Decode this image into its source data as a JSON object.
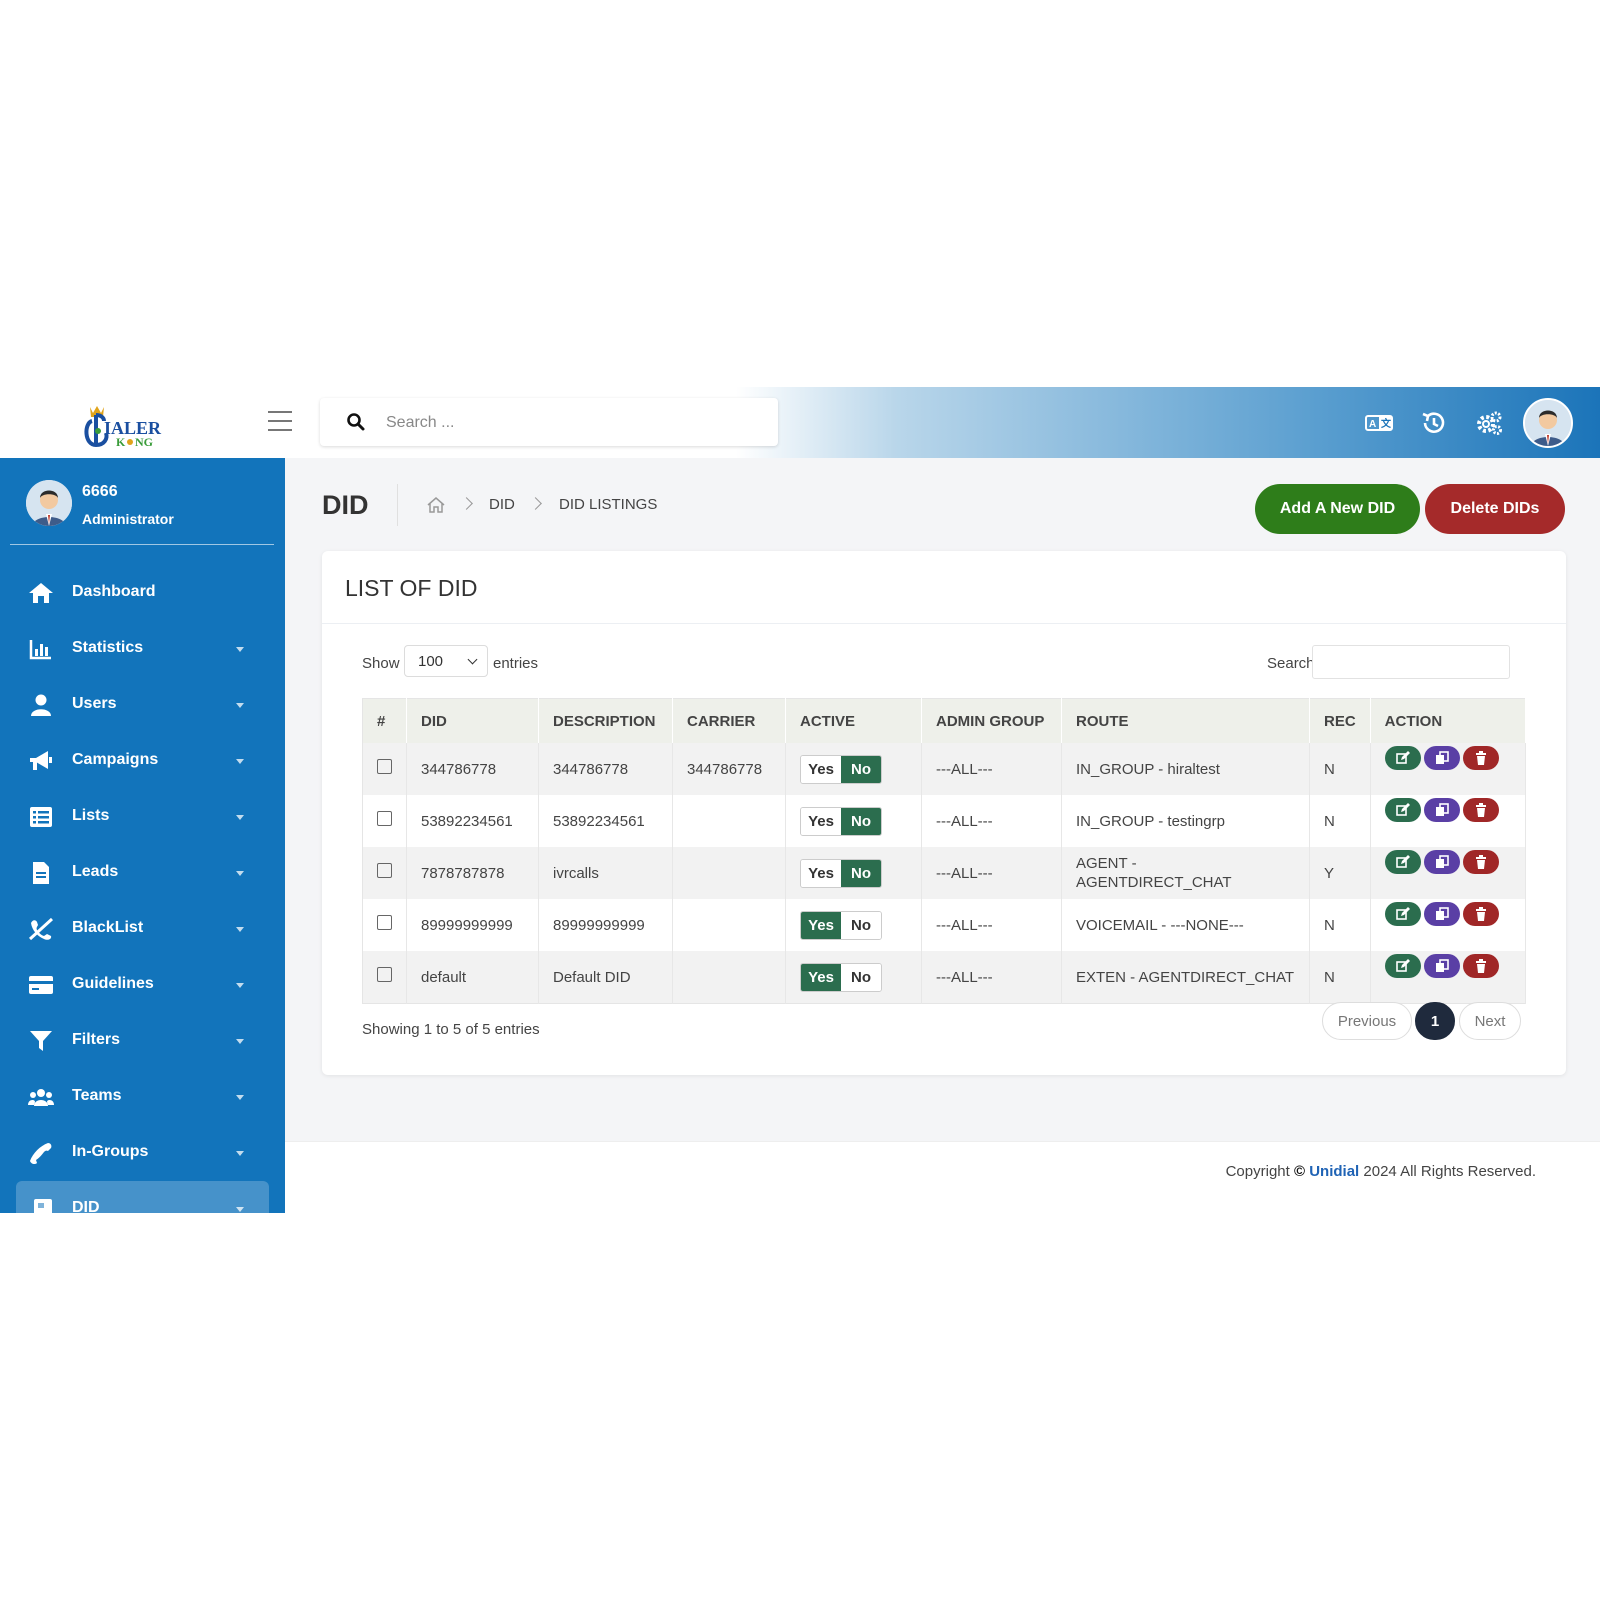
{
  "brand": {
    "logo_main": "IALER",
    "logo_sub": "KING",
    "logo_letter": "D"
  },
  "search": {
    "placeholder": "Search ..."
  },
  "topbar_icons": [
    "translate-icon",
    "history-icon",
    "settings-icon",
    "user-avatar"
  ],
  "user": {
    "name": "6666",
    "role": "Administrator"
  },
  "sidebar": {
    "items": [
      {
        "label": "Dashboard",
        "icon": "home-icon",
        "has_caret": false
      },
      {
        "label": "Statistics",
        "icon": "bar-chart-icon",
        "has_caret": true
      },
      {
        "label": "Users",
        "icon": "user-icon",
        "has_caret": true
      },
      {
        "label": "Campaigns",
        "icon": "megaphone-icon",
        "has_caret": true
      },
      {
        "label": "Lists",
        "icon": "list-icon",
        "has_caret": true
      },
      {
        "label": "Leads",
        "icon": "document-icon",
        "has_caret": true
      },
      {
        "label": "BlackList",
        "icon": "blocked-phone-icon",
        "has_caret": true
      },
      {
        "label": "Guidelines",
        "icon": "card-icon",
        "has_caret": true
      },
      {
        "label": "Filters",
        "icon": "filter-icon",
        "has_caret": true
      },
      {
        "label": "Teams",
        "icon": "users-icon",
        "has_caret": true
      },
      {
        "label": "In-Groups",
        "icon": "phone-icon",
        "has_caret": true
      },
      {
        "label": "DID",
        "icon": "did-icon",
        "has_caret": true,
        "active": true
      }
    ]
  },
  "page": {
    "title": "DID",
    "breadcrumb": [
      "DID",
      "DID LISTINGS"
    ],
    "add_button": "Add A New DID",
    "delete_button": "Delete DIDs"
  },
  "card": {
    "title": "LIST OF DID",
    "show_label": "Show",
    "show_value": "100",
    "entries_label": "entries",
    "search_label": "Search:",
    "columns": [
      "#",
      "DID",
      "DESCRIPTION",
      "CARRIER",
      "ACTIVE",
      "ADMIN GROUP",
      "ROUTE",
      "REC",
      "ACTION"
    ],
    "rows": [
      {
        "did": "344786778",
        "description": "344786778",
        "carrier": "344786778",
        "active": "No",
        "admin_group": "---ALL---",
        "route": "IN_GROUP - hiraltest",
        "rec": "N"
      },
      {
        "did": "53892234561",
        "description": "53892234561",
        "carrier": "",
        "active": "No",
        "admin_group": "---ALL---",
        "route": "IN_GROUP - testingrp",
        "rec": "N"
      },
      {
        "did": "7878787878",
        "description": "ivrcalls",
        "carrier": "",
        "active": "No",
        "admin_group": "---ALL---",
        "route": "AGENT - AGENTDIRECT_CHAT",
        "rec": "Y"
      },
      {
        "did": "89999999999",
        "description": "89999999999",
        "carrier": "",
        "active": "Yes",
        "admin_group": "---ALL---",
        "route": "VOICEMAIL - ---NONE---",
        "rec": "N"
      },
      {
        "did": "default",
        "description": "Default DID",
        "carrier": "",
        "active": "Yes",
        "admin_group": "---ALL---",
        "route": "EXTEN - AGENTDIRECT_CHAT",
        "rec": "N"
      }
    ],
    "toggle_yes": "Yes",
    "toggle_no": "No",
    "info": "Showing 1 to 5 of 5 entries",
    "pagination": {
      "previous": "Previous",
      "current": "1",
      "next": "Next"
    }
  },
  "footer": {
    "prefix": "Copyright",
    "symbol": "©",
    "brand": "Unidial",
    "suffix": "2024 All Rights Reserved."
  },
  "colors": {
    "sidebar": "#1274bb",
    "add_button": "#2e7d1a",
    "delete_button": "#a52a2a",
    "toggle_on": "#2b6d4e",
    "copy_button": "#5a3fa5"
  }
}
